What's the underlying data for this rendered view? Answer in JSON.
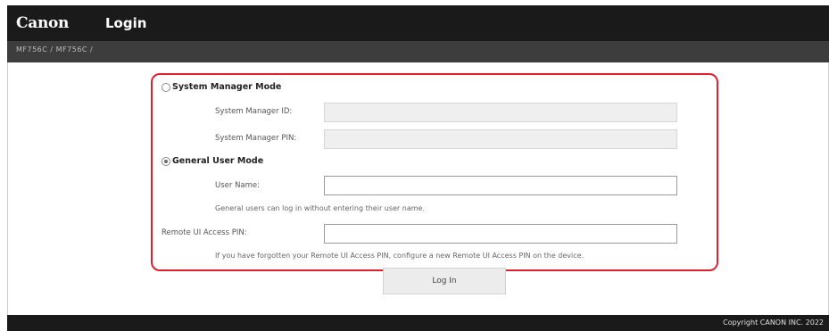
{
  "header": {
    "brand": "Canon",
    "title": "Login"
  },
  "subbar": {
    "device_model": "MF756C / MF756C /"
  },
  "login": {
    "system_manager_mode": {
      "label": "System Manager Mode",
      "selected": false,
      "id_label": "System Manager ID:",
      "id_value": "",
      "pin_label": "System Manager PIN:",
      "pin_value": "",
      "enabled": false
    },
    "general_user_mode": {
      "label": "General User Mode",
      "selected": true,
      "username_label": "User Name:",
      "username_value": "",
      "hint": "General users can log in without entering their user name."
    },
    "remote_ui_pin": {
      "label": "Remote UI Access PIN:",
      "value": "",
      "hint": "If you have forgotten your Remote UI Access PIN, configure a new Remote UI Access PIN on the device."
    },
    "login_button": "Log In"
  },
  "footer": {
    "copyright": "Copyright CANON INC. 2022"
  },
  "colors": {
    "header_bg": "#1a1a1a",
    "highlight_border": "#e0202c"
  }
}
